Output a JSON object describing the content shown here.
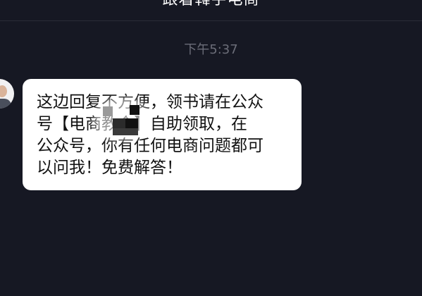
{
  "header": {
    "title": "跟着韓宇电商"
  },
  "timestamp": "下午5:37",
  "message": {
    "lines": [
      "这边回复不方便，领书请在公众",
      "号【电商教会】自助领取，在",
      "公众号，你有任何电商问题都可",
      "以问我！免费解答！"
    ]
  },
  "colors": {
    "background": "#161823",
    "bubble": "#ffffff",
    "text": "#111111",
    "timestamp": "#6b6d78"
  }
}
